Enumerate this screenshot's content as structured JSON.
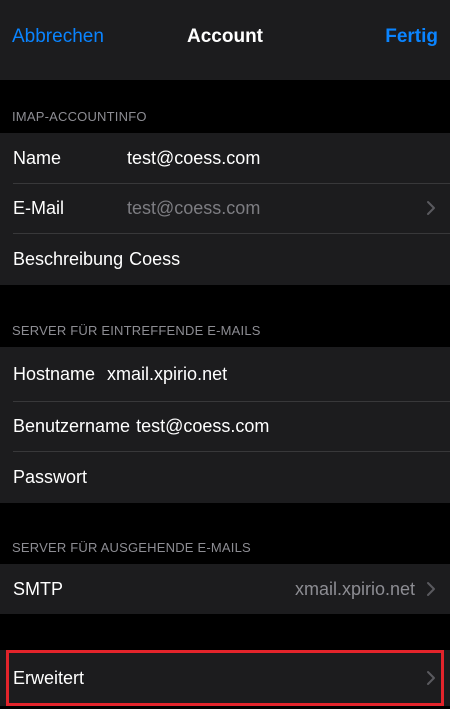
{
  "navbar": {
    "cancel_label": "Abbrechen",
    "title": "Account",
    "done_label": "Fertig"
  },
  "sections": {
    "imap_header": "IMAP-ACCOUNTINFO",
    "incoming_header": "SERVER FÜR EINTREFFENDE E-MAILS",
    "outgoing_header": "SERVER FÜR AUSGEHENDE E-MAILS"
  },
  "account": {
    "name_label": "Name",
    "name_value": "test@coess.com",
    "email_label": "E-Mail",
    "email_value": "test@coess.com",
    "description_label": "Beschreibung",
    "description_value": "Coess"
  },
  "incoming": {
    "hostname_label": "Hostname",
    "hostname_value": "xmail.xpirio.net",
    "username_label": "Benutzername",
    "username_value": "test@coess.com",
    "password_label": "Passwort"
  },
  "outgoing": {
    "smtp_label": "SMTP",
    "smtp_value": "xmail.xpirio.net"
  },
  "advanced": {
    "label": "Erweitert"
  },
  "colors": {
    "accent": "#0a84ff",
    "highlight": "#e3242b",
    "background": "#000000",
    "cell": "#1c1c1e"
  }
}
